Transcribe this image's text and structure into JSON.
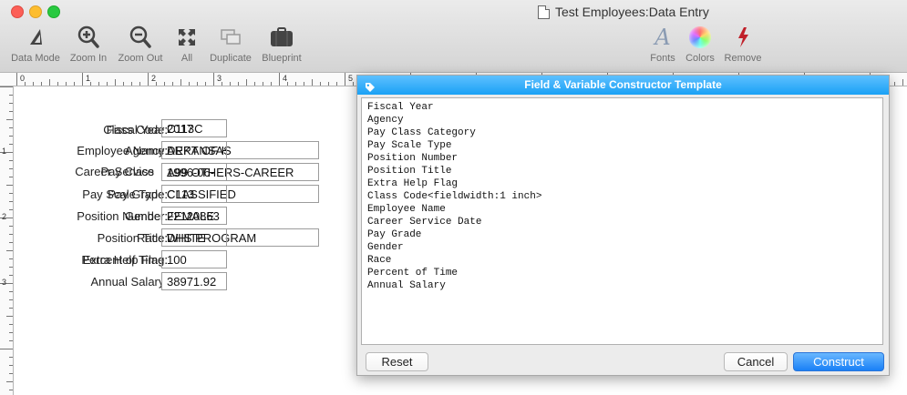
{
  "window": {
    "title": "Test Employees:Data Entry"
  },
  "toolbar": {
    "data_mode": "Data Mode",
    "zoom_in": "Zoom In",
    "zoom_out": "Zoom Out",
    "all": "All",
    "duplicate": "Duplicate",
    "blueprint": "Blueprint",
    "fonts": "Fonts",
    "colors": "Colors",
    "remove": "Remove"
  },
  "ruler": {
    "h": [
      "0",
      "1",
      "2",
      "3",
      "4",
      "5"
    ],
    "v": [
      "1",
      "2",
      "3"
    ]
  },
  "form": {
    "labels_back": [
      "Fiscal Year:",
      "Agency:",
      "Pay Class",
      "Pay Scale Type:",
      "Position Number:",
      "Position Title:",
      "Extra Help Flag:"
    ],
    "labels_front": [
      "Class Code:",
      "Employee Name:",
      "Career Service",
      "Pay Grade:",
      "Gender:",
      "Race:",
      "Percent of Time:",
      "Annual Salary:"
    ],
    "values_back": [
      "2017",
      "ARKANSAS",
      "A99 OTHERS-CAREER",
      "CLASSIFIED",
      "22120863",
      "DHS PROGRAM",
      ""
    ],
    "values_front": [
      "C113C",
      "DEPT OF HUMAN",
      "1996-06-",
      "C113",
      "FEMALE",
      "WHITE",
      "100",
      "38971.92"
    ]
  },
  "dialog": {
    "title": "Field & Variable Constructor Template",
    "lines": [
      "Fiscal Year",
      "Agency",
      "Pay Class Category",
      "Pay Scale Type",
      "Position Number",
      "Position Title",
      "Extra Help Flag",
      "Class Code<fieldwidth:1 inch>",
      "Employee Name",
      "Career Service Date",
      "Pay Grade",
      "Gender",
      "Race",
      "Percent of Time",
      "Annual Salary"
    ],
    "reset": "Reset",
    "cancel": "Cancel",
    "construct": "Construct"
  }
}
